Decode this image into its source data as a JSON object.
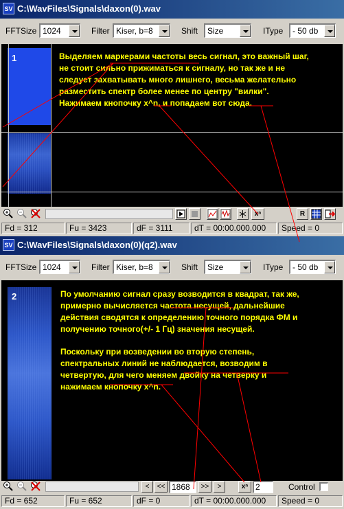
{
  "window1": {
    "title": "C:\\WavFiles\\Signals\\daxon(0).wav",
    "toolbar": {
      "fftsize_label": "FFTSize",
      "fftsize_value": "1024",
      "filter_label": "Filter",
      "filter_value": "Kiser, b=8",
      "shift_label": "Shift",
      "shift_value": "Size",
      "itype_label": "IType",
      "itype_value": "- 50 db"
    },
    "plot_number": "1",
    "note": "Выделяем маркерами частоты весь сигнал, это важный шаг,\nне стоит сильно прижиматься к сигналу, но так же и не\nследует захватывать много лишнего, весьма желательно\nразместить спектр более менее по центру \"вилки\".\nНажимаем кнопочку x^n, и попадаем вот сюда.",
    "buttons": {
      "r_label": "R",
      "xn_label": "xⁿ"
    },
    "status": {
      "fd": "Fd = 312",
      "fu": "Fu = 3423",
      "df": "dF = 3111",
      "dt": "dT = 00:00.000.000",
      "speed": "Speed = 0"
    }
  },
  "window2": {
    "title": "C:\\WavFiles\\Signals\\daxon(0)(q2).wav",
    "toolbar": {
      "fftsize_label": "FFTSize",
      "fftsize_value": "1024",
      "filter_label": "Filter",
      "filter_value": "Kiser, b=8",
      "shift_label": "Shift",
      "shift_value": "Size",
      "itype_label": "IType",
      "itype_value": "- 50 db"
    },
    "plot_number": "2",
    "note1": "По умолчанию сигнал сразу возводится в квадрат, так же,\nпримерно вычисляется частота несущей, дальнейшие\nдействия сводятся к определению точного порядка ФМ и\nполучению точного(+/- 1 Гц) значения несущей.",
    "note2": "Поскольку при возведении во вторую степень,\nспектральных линий не наблюдается, возводим в\nчетвертую, для чего меняем двойку на четверку и\nнажимаем кнопочку x^n.",
    "nav": {
      "prev": "<",
      "prev_fast": "<<",
      "value": "1868",
      "next_fast": ">>",
      "next": ">"
    },
    "xn_label": "xⁿ",
    "power_value": "2",
    "control_label": "Control",
    "status": {
      "fd": "Fd = 652",
      "fu": "Fu = 652",
      "df": "dF = 0",
      "dt": "dT = 00:00.000.000",
      "speed": "Speed = 0"
    }
  }
}
